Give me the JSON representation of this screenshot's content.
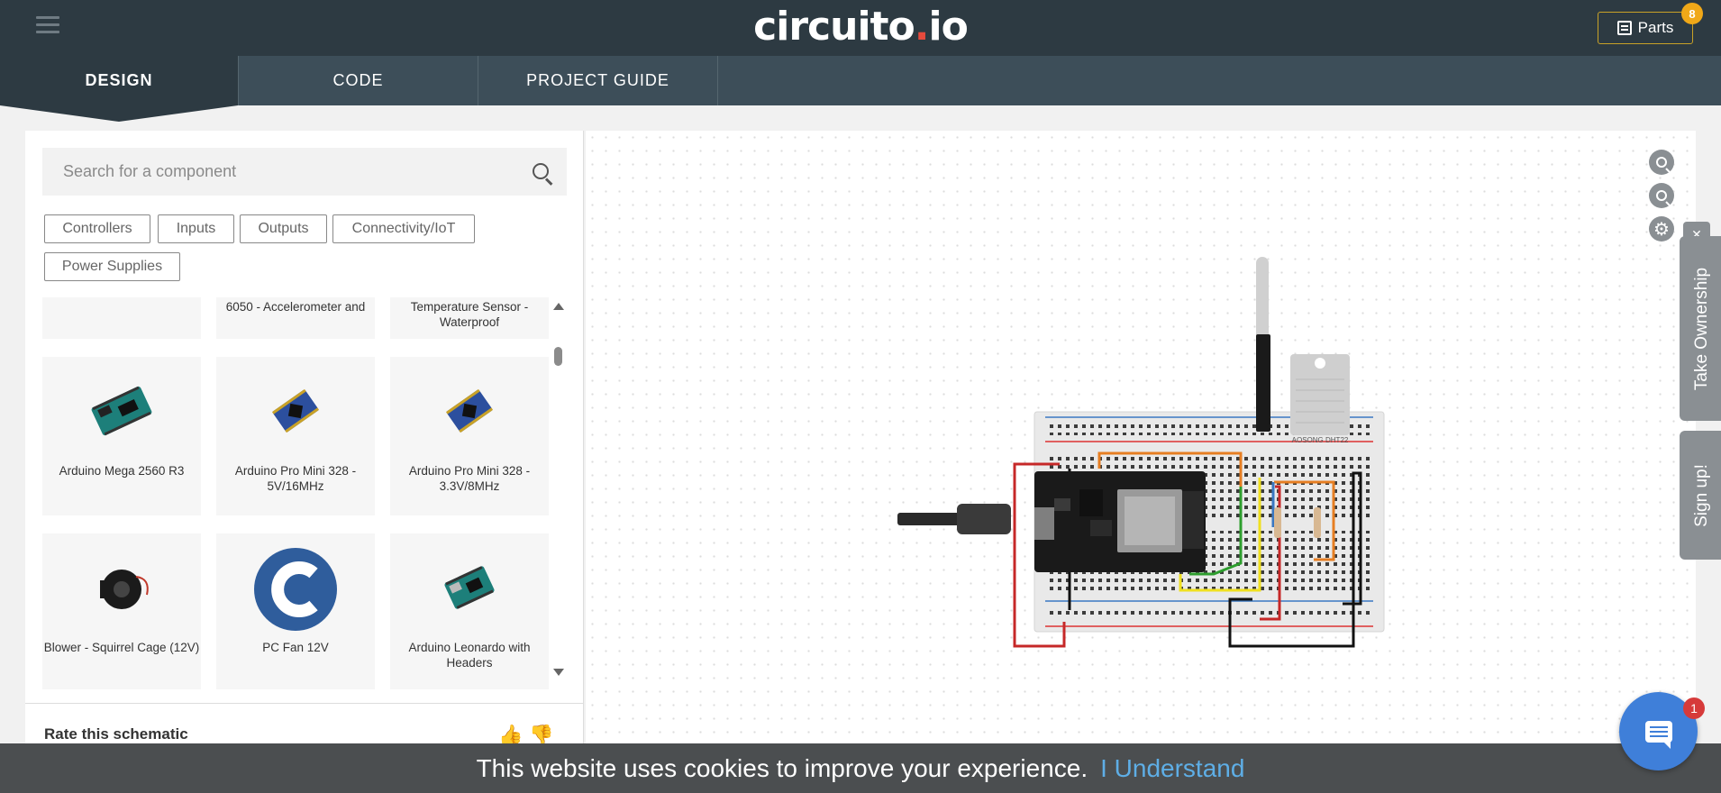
{
  "header": {
    "logo_main": "circuito",
    "logo_dot": ".",
    "logo_tail": "io",
    "parts_label": "Parts",
    "parts_count": "8"
  },
  "tabs": [
    {
      "label": "DESIGN",
      "active": true
    },
    {
      "label": "CODE",
      "active": false
    },
    {
      "label": "PROJECT GUIDE",
      "active": false
    }
  ],
  "search": {
    "placeholder": "Search for a component",
    "value": ""
  },
  "filters": [
    "Controllers",
    "Inputs",
    "Outputs",
    "Connectivity/IoT",
    "Power Supplies"
  ],
  "components": [
    {
      "label": "",
      "icon": "blank"
    },
    {
      "label": "6050 - Accelerometer and",
      "icon": "module"
    },
    {
      "label": "Temperature Sensor - Waterproof",
      "icon": "sensor"
    },
    {
      "label": "Arduino Mega 2560 R3",
      "icon": "arduino-mega-icon"
    },
    {
      "label": "Arduino Pro Mini 328 - 5V/16MHz",
      "icon": "pro-mini-icon"
    },
    {
      "label": "Arduino Pro Mini 328 - 3.3V/8MHz",
      "icon": "pro-mini-icon"
    },
    {
      "label": "Blower - Squirrel Cage (12V)",
      "icon": "blower-icon"
    },
    {
      "label": "PC Fan 12V",
      "icon": "circuito-c-icon"
    },
    {
      "label": "Arduino Leonardo with Headers",
      "icon": "arduino-leonardo-icon"
    }
  ],
  "rate_label": "Rate this schematic",
  "canvas": {
    "sensor_label": "AOSONG DHT22",
    "side_tabs": [
      "Take Ownership",
      "Sign up!"
    ],
    "collapse_label": "✕"
  },
  "cookie": {
    "message": "This website uses cookies to improve your experience.",
    "action": "I Understand"
  },
  "chat": {
    "badge": "1"
  },
  "colors": {
    "header": "#2d3a42",
    "tabbar": "#3d4e59",
    "accent": "#e64a3c",
    "badge": "#f0a818",
    "link": "#5eaee6"
  }
}
